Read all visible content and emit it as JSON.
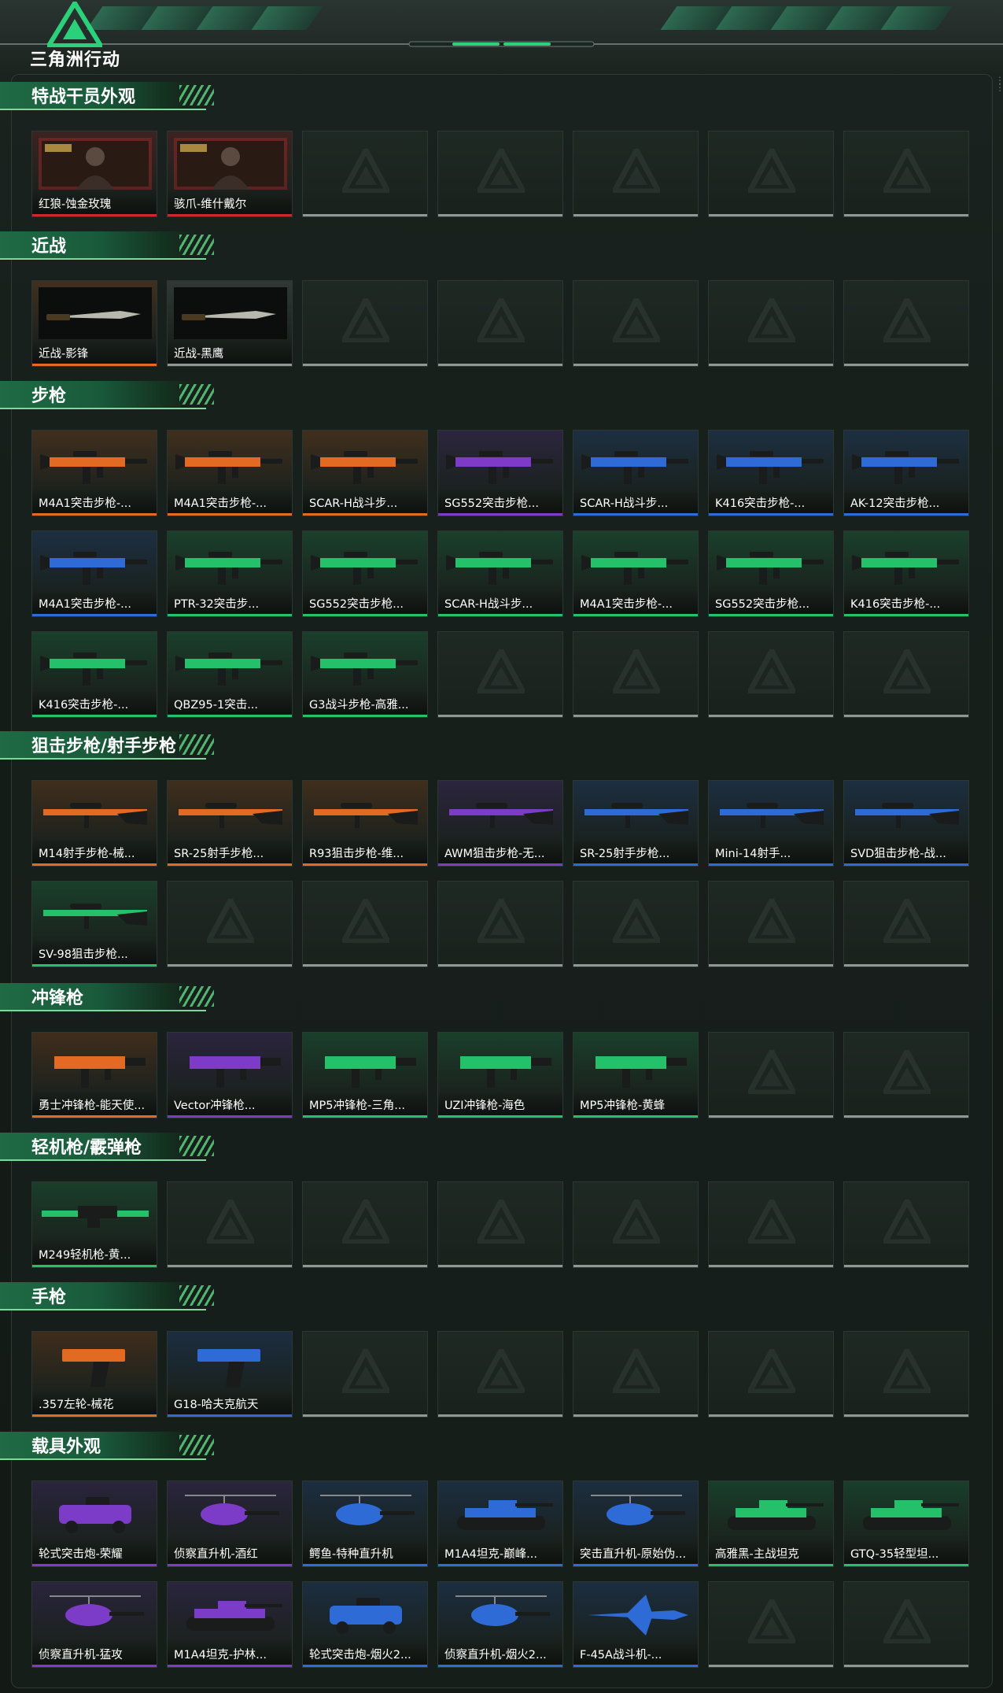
{
  "app": {
    "title": "三角洲行动"
  },
  "colors": {
    "accent_green": "#2bd17a",
    "orange": "#e36a22",
    "purple": "#7c3cc8",
    "blue": "#2f6bd6",
    "red": "#c9282c",
    "green": "#25c06a",
    "grey": "#8e9894"
  },
  "sections": [
    {
      "title": "特战干员外观",
      "rows": [
        [
          {
            "label": "红狼-蚀金玫瑰",
            "rarity": "red",
            "icon": "operator-portrait"
          },
          {
            "label": "骇爪-维什戴尔",
            "rarity": "red",
            "icon": "operator-portrait"
          },
          null,
          null,
          null,
          null,
          null
        ]
      ]
    },
    {
      "title": "近战",
      "rows": [
        [
          {
            "label": "近战-影锋",
            "rarity": "orange",
            "icon": "knife"
          },
          {
            "label": "近战-黑鹰",
            "rarity": "grey",
            "icon": "knife"
          },
          null,
          null,
          null,
          null,
          null
        ]
      ]
    },
    {
      "title": "步枪",
      "rows": [
        [
          {
            "label": "M4A1突击步枪-...",
            "rarity": "orange",
            "icon": "rifle"
          },
          {
            "label": "M4A1突击步枪-...",
            "rarity": "orange",
            "icon": "rifle"
          },
          {
            "label": "SCAR-H战斗步...",
            "rarity": "orange",
            "icon": "rifle"
          },
          {
            "label": "SG552突击步枪...",
            "rarity": "purple",
            "icon": "rifle"
          },
          {
            "label": "SCAR-H战斗步...",
            "rarity": "blue",
            "icon": "rifle"
          },
          {
            "label": "K416突击步枪-...",
            "rarity": "blue",
            "icon": "rifle"
          },
          {
            "label": "AK-12突击步枪...",
            "rarity": "blue",
            "icon": "rifle"
          }
        ],
        [
          {
            "label": "M4A1突击步枪-...",
            "rarity": "blue",
            "icon": "rifle"
          },
          {
            "label": "PTR-32突击步...",
            "rarity": "green",
            "icon": "rifle"
          },
          {
            "label": "SG552突击步枪...",
            "rarity": "green",
            "icon": "rifle"
          },
          {
            "label": "SCAR-H战斗步...",
            "rarity": "green",
            "icon": "rifle"
          },
          {
            "label": "M4A1突击步枪-...",
            "rarity": "green",
            "icon": "rifle"
          },
          {
            "label": "SG552突击步枪...",
            "rarity": "green",
            "icon": "rifle"
          },
          {
            "label": "K416突击步枪-...",
            "rarity": "green",
            "icon": "rifle"
          }
        ],
        [
          {
            "label": "K416突击步枪-...",
            "rarity": "green",
            "icon": "rifle"
          },
          {
            "label": "QBZ95-1突击...",
            "rarity": "green",
            "icon": "rifle"
          },
          {
            "label": "G3战斗步枪-高雅...",
            "rarity": "green",
            "icon": "rifle"
          },
          null,
          null,
          null,
          null
        ]
      ]
    },
    {
      "title": "狙击步枪/射手步枪",
      "rows": [
        [
          {
            "label": "M14射手步枪-械...",
            "rarity": "orange",
            "icon": "sniper"
          },
          {
            "label": "SR-25射手步枪...",
            "rarity": "orange",
            "icon": "sniper"
          },
          {
            "label": "R93狙击步枪-维...",
            "rarity": "orange",
            "icon": "sniper"
          },
          {
            "label": "AWM狙击步枪-无...",
            "rarity": "purple",
            "icon": "sniper"
          },
          {
            "label": "SR-25射手步枪...",
            "rarity": "blue",
            "icon": "sniper"
          },
          {
            "label": "Mini-14射手...",
            "rarity": "blue",
            "icon": "sniper"
          },
          {
            "label": "SVD狙击步枪-战...",
            "rarity": "blue",
            "icon": "sniper"
          }
        ],
        [
          {
            "label": "SV-98狙击步枪...",
            "rarity": "green",
            "icon": "sniper"
          },
          null,
          null,
          null,
          null,
          null,
          null
        ]
      ]
    },
    {
      "title": "冲锋枪",
      "rows": [
        [
          {
            "label": "勇士冲锋枪-能天使...",
            "rarity": "orange",
            "icon": "smg"
          },
          {
            "label": "Vector冲锋枪...",
            "rarity": "purple",
            "icon": "smg"
          },
          {
            "label": "MP5冲锋枪-三角...",
            "rarity": "green",
            "icon": "smg"
          },
          {
            "label": "UZI冲锋枪-海色",
            "rarity": "green",
            "icon": "smg"
          },
          {
            "label": "MP5冲锋枪-黄蜂",
            "rarity": "green",
            "icon": "smg"
          },
          null,
          null
        ]
      ]
    },
    {
      "title": "轻机枪/霰弹枪",
      "rows": [
        [
          {
            "label": "M249轻机枪-黄...",
            "rarity": "green",
            "icon": "lmg"
          },
          null,
          null,
          null,
          null,
          null,
          null
        ]
      ]
    },
    {
      "title": "手枪",
      "rows": [
        [
          {
            "label": ".357左轮-械花",
            "rarity": "orange",
            "icon": "pistol"
          },
          {
            "label": "G18-哈夫克航天",
            "rarity": "blue",
            "icon": "pistol"
          },
          null,
          null,
          null,
          null,
          null
        ]
      ]
    },
    {
      "title": "载具外观",
      "rows": [
        [
          {
            "label": "轮式突击炮-荣耀",
            "rarity": "purple",
            "icon": "vehicle"
          },
          {
            "label": "侦察直升机-酒红",
            "rarity": "purple",
            "icon": "helicopter"
          },
          {
            "label": "鳄鱼-特种直升机",
            "rarity": "blue",
            "icon": "helicopter"
          },
          {
            "label": "M1A4坦克-巅峰...",
            "rarity": "blue",
            "icon": "tank"
          },
          {
            "label": "突击直升机-原始伪...",
            "rarity": "blue",
            "icon": "helicopter"
          },
          {
            "label": "高雅黑-主战坦克",
            "rarity": "green",
            "icon": "tank"
          },
          {
            "label": "GTQ-35轻型坦...",
            "rarity": "green",
            "icon": "tank"
          }
        ],
        [
          {
            "label": "侦察直升机-猛攻",
            "rarity": "purple",
            "icon": "helicopter"
          },
          {
            "label": "M1A4坦克-护林...",
            "rarity": "purple",
            "icon": "tank"
          },
          {
            "label": "轮式突击炮-烟火2...",
            "rarity": "blue",
            "icon": "vehicle"
          },
          {
            "label": "侦察直升机-烟火2...",
            "rarity": "blue",
            "icon": "helicopter"
          },
          {
            "label": "F-45A战斗机-...",
            "rarity": "blue",
            "icon": "jet"
          },
          null,
          null
        ]
      ]
    }
  ]
}
